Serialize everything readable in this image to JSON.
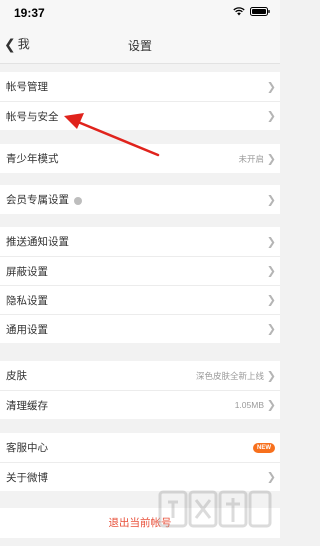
{
  "status_bar": {
    "time": "19:37"
  },
  "navbar": {
    "back_label": "我",
    "title": "设置"
  },
  "groups": [
    {
      "items": [
        {
          "label": "帐号管理"
        },
        {
          "label": "帐号与安全"
        }
      ]
    },
    {
      "items": [
        {
          "label": "青少年模式",
          "value": "未开启"
        }
      ]
    },
    {
      "items": [
        {
          "label": "会员专属设置"
        }
      ]
    },
    {
      "items": [
        {
          "label": "推送通知设置"
        },
        {
          "label": "屏蔽设置"
        },
        {
          "label": "隐私设置"
        },
        {
          "label": "通用设置"
        }
      ]
    },
    {
      "items": [
        {
          "label": "皮肤",
          "value": "深色皮肤全新上线"
        },
        {
          "label": "清理缓存",
          "value": "1.05MB"
        }
      ]
    },
    {
      "items": [
        {
          "label": "客服中心",
          "badge": "NEW"
        },
        {
          "label": "关于微博"
        }
      ]
    }
  ],
  "logout_label": "退出当前帐号",
  "colors": {
    "accent": "#e8503a",
    "badge": "#f7701d",
    "annotation_arrow": "#e0231c"
  },
  "icons": [
    "wifi-icon",
    "battery-icon",
    "chevron-left-icon",
    "chevron-right-icon",
    "vip-icon",
    "annotation-arrow"
  ]
}
